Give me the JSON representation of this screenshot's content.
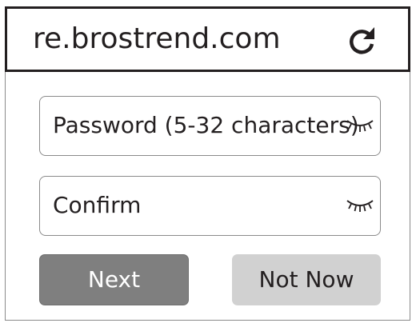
{
  "browser": {
    "url": "re.brostrend.com",
    "reload_icon": "reload-icon"
  },
  "form": {
    "password_placeholder": "Password (5-32 characters)",
    "confirm_placeholder": "Confirm",
    "visibility_icon": "eye-closed-icon"
  },
  "actions": {
    "next_label": "Next",
    "not_now_label": "Not Now"
  },
  "colors": {
    "text": "#231f20",
    "next_button": "#7f7f7f",
    "not_now_button": "#d1d1d1",
    "border": "#8a8a8a"
  }
}
